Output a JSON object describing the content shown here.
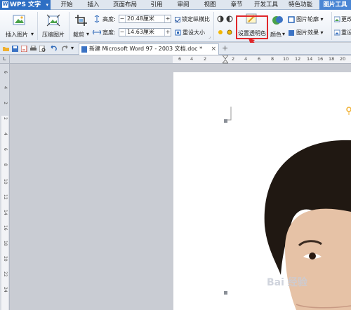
{
  "app": {
    "name": "WPS 文字"
  },
  "menu_tabs": [
    {
      "label": "开始"
    },
    {
      "label": "插入"
    },
    {
      "label": "页面布局"
    },
    {
      "label": "引用"
    },
    {
      "label": "审阅"
    },
    {
      "label": "视图"
    },
    {
      "label": "章节"
    },
    {
      "label": "开发工具"
    },
    {
      "label": "特色功能"
    },
    {
      "label": "图片工具",
      "active": true
    }
  ],
  "ribbon": {
    "insert_picture": "插入图片",
    "compress_picture": "压缩图片",
    "crop": "裁剪",
    "height_label": "高度:",
    "height_value": "20.48厘米",
    "width_label": "宽度:",
    "width_value": "14.63厘米",
    "lock_aspect": "锁定纵横比",
    "reset_size": "重设大小",
    "set_transparent": "设置透明色",
    "color": "颜色",
    "picture_outline": "图片轮廓",
    "picture_effects": "图片效果",
    "change_picture": "更改",
    "reset_picture": "重设",
    "minus": "−",
    "plus": "+"
  },
  "document_tab": {
    "title": "新建 Microsoft Word 97 - 2003 文档.doc *",
    "close": "×",
    "new": "+"
  },
  "ruler": {
    "corner": "L",
    "h_numbers": [
      "6",
      "4",
      "2",
      "2",
      "4",
      "6",
      "8",
      "10",
      "12",
      "14",
      "16",
      "18",
      "20"
    ],
    "v_numbers": [
      "6",
      "4",
      "2",
      "2",
      "4",
      "6",
      "8",
      "10",
      "12",
      "14",
      "16",
      "18",
      "20",
      "22",
      "24"
    ]
  },
  "watermark": "Bai 经验",
  "colors": {
    "accent": "#2e6fc4",
    "active_tab": "#4a86d4",
    "highlight": "#e0272b"
  }
}
